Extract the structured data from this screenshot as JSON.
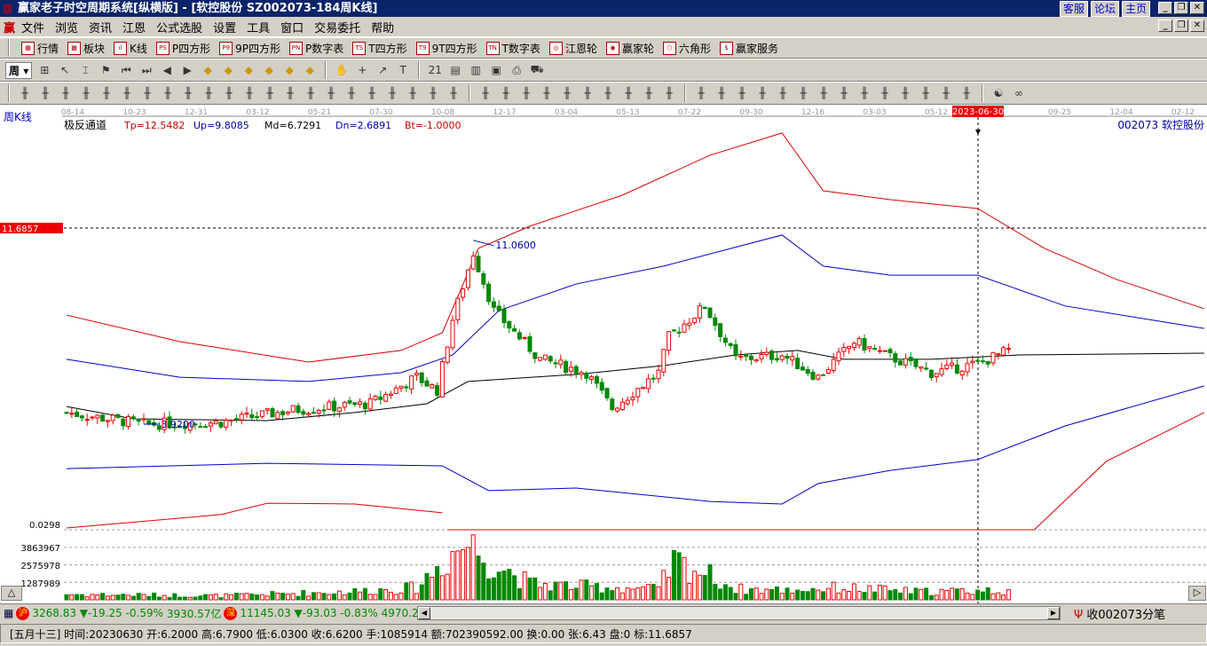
{
  "window": {
    "title": "赢家老子时空周期系统[纵横版] - [软控股份   SZ002073-184周K线]",
    "links": [
      "客服",
      "论坛",
      "主页"
    ],
    "logo": "赢"
  },
  "menu": [
    "文件",
    "浏览",
    "资讯",
    "江恩",
    "公式选股",
    "设置",
    "工具",
    "窗口",
    "交易委托",
    "帮助"
  ],
  "toolbar1": [
    {
      "icon": "quote-table-icon",
      "label": "行情",
      "glyph": "▦"
    },
    {
      "icon": "sector-icon",
      "label": "板块",
      "glyph": "▩"
    },
    {
      "icon": "kline-icon",
      "label": "K线",
      "glyph": "ıl"
    },
    {
      "icon": "ps-icon",
      "label": "P四方形",
      "glyph": "PS"
    },
    {
      "icon": "p9-icon",
      "label": "9P四方形",
      "glyph": "P9"
    },
    {
      "icon": "pn-icon",
      "label": "P数字表",
      "glyph": "PN"
    },
    {
      "icon": "ts-icon",
      "label": "T四方形",
      "glyph": "TS"
    },
    {
      "icon": "t9-icon",
      "label": "9T四方形",
      "glyph": "T9"
    },
    {
      "icon": "tn-icon",
      "label": "T数字表",
      "glyph": "TN"
    },
    {
      "icon": "gann-wheel-icon",
      "label": "江恩轮",
      "glyph": "◎"
    },
    {
      "icon": "winner-wheel-icon",
      "label": "赢家轮",
      "glyph": "◉"
    },
    {
      "icon": "hexagon-icon",
      "label": "六角形",
      "glyph": "⬡"
    },
    {
      "icon": "dollar-icon",
      "label": "赢家服务",
      "glyph": "$"
    }
  ],
  "period": "周",
  "chart": {
    "period_label": "周K线",
    "indicator_name": "极反通道",
    "tp": "Tp=12.5482",
    "up": "Up=9.8085",
    "md": "Md=6.7291",
    "dn": "Dn=2.6891",
    "bt": "Bt=-1.0000",
    "stock": "002073  软控股份",
    "price_marker": "11.6857",
    "high_label": "11.0600",
    "low_label": "3.9200",
    "indicator_value": "0.0298",
    "vol_ticks": [
      "3863967",
      "2575978",
      "1287989"
    ],
    "dates": [
      "08-14",
      "10-23",
      "12-31",
      "03-12",
      "05-21",
      "07-30",
      "10-08",
      "12-17",
      "03-04",
      "05-13",
      "07-22",
      "09-30",
      "12-16",
      "03-03",
      "05-12",
      "2023-06-30",
      "09-25",
      "12-04",
      "02-12"
    ]
  },
  "chart_data": {
    "type": "candlestick",
    "weeks": 184,
    "close_keypoints": [
      [
        0,
        4.38
      ],
      [
        15,
        3.92
      ],
      [
        30,
        4.0
      ],
      [
        44,
        4.48
      ],
      [
        59,
        4.73
      ],
      [
        68,
        5.78
      ],
      [
        72,
        5.26
      ],
      [
        75,
        8.07
      ],
      [
        79,
        10.7
      ],
      [
        83,
        8.42
      ],
      [
        92,
        6.49
      ],
      [
        101,
        5.96
      ],
      [
        106,
        4.55
      ],
      [
        115,
        5.96
      ],
      [
        117,
        7.37
      ],
      [
        124,
        8.6
      ],
      [
        130,
        6.49
      ],
      [
        139,
        6.66
      ],
      [
        146,
        5.78
      ],
      [
        153,
        7.19
      ],
      [
        159,
        6.66
      ],
      [
        168,
        5.96
      ],
      [
        177,
        6.31
      ],
      [
        183,
        6.84
      ]
    ],
    "channels": {
      "tp": [
        [
          0,
          8.24
        ],
        [
          22,
          7.19
        ],
        [
          47,
          6.38
        ],
        [
          65,
          6.84
        ],
        [
          73,
          7.54
        ],
        [
          80,
          10.88
        ],
        [
          90,
          11.76
        ],
        [
          108,
          12.99
        ],
        [
          125,
          14.57
        ],
        [
          139,
          15.45
        ],
        [
          147,
          13.16
        ],
        [
          160,
          12.81
        ],
        [
          177,
          12.46
        ],
        [
          190,
          10.88
        ],
        [
          204,
          9.65
        ],
        [
          221,
          8.49
        ]
      ],
      "up": [
        [
          0,
          6.49
        ],
        [
          22,
          5.78
        ],
        [
          47,
          5.61
        ],
        [
          65,
          5.96
        ],
        [
          75,
          6.66
        ],
        [
          84,
          8.42
        ],
        [
          99,
          9.47
        ],
        [
          116,
          10.18
        ],
        [
          139,
          11.41
        ],
        [
          147,
          10.18
        ],
        [
          160,
          9.82
        ],
        [
          177,
          9.82
        ],
        [
          194,
          8.6
        ],
        [
          221,
          7.71
        ]
      ],
      "md": [
        [
          0,
          4.62
        ],
        [
          13,
          4.13
        ],
        [
          39,
          4.06
        ],
        [
          56,
          4.38
        ],
        [
          70,
          4.73
        ],
        [
          78,
          5.61
        ],
        [
          99,
          5.89
        ],
        [
          116,
          6.24
        ],
        [
          130,
          6.66
        ],
        [
          142,
          6.84
        ],
        [
          151,
          6.49
        ],
        [
          168,
          6.49
        ],
        [
          185,
          6.66
        ],
        [
          221,
          6.73
        ]
      ],
      "dn": [
        [
          0,
          2.16
        ],
        [
          39,
          2.37
        ],
        [
          73,
          2.27
        ],
        [
          82,
          1.29
        ],
        [
          99,
          1.39
        ],
        [
          125,
          0.86
        ],
        [
          139,
          0.76
        ],
        [
          146,
          1.57
        ],
        [
          160,
          2.09
        ],
        [
          177,
          2.52
        ],
        [
          194,
          3.85
        ],
        [
          221,
          5.43
        ]
      ],
      "bt_a": [
        [
          0,
          -0.19
        ],
        [
          30,
          0.34
        ],
        [
          39,
          0.79
        ],
        [
          56,
          0.76
        ],
        [
          73,
          0.41
        ]
      ],
      "bt_b": [
        [
          74,
          -0.26
        ],
        [
          188,
          -0.26
        ],
        [
          202,
          2.45
        ],
        [
          221,
          4.38
        ]
      ]
    },
    "volume_keypoints": [
      [
        0,
        400000
      ],
      [
        30,
        300000
      ],
      [
        55,
        600000
      ],
      [
        68,
        900000
      ],
      [
        75,
        3500000
      ],
      [
        78,
        4200000
      ],
      [
        82,
        3000000
      ],
      [
        90,
        1200000
      ],
      [
        100,
        1000000
      ],
      [
        115,
        800000
      ],
      [
        118,
        2800000
      ],
      [
        124,
        2000000
      ],
      [
        130,
        800000
      ],
      [
        140,
        700000
      ],
      [
        150,
        900000
      ],
      [
        165,
        600000
      ],
      [
        183,
        700000
      ]
    ],
    "price_marker": 11.6857,
    "selected_week": 177
  },
  "status": {
    "sh_index": "3268.83",
    "sh_change": "▼-19.25",
    "sh_pct": "-0.59%",
    "sh_amount": "3930.57亿",
    "sz_index": "11145.03",
    "sz_change": "▼-93.03",
    "sz_pct": "-0.83%",
    "sz_amount": "4970.2",
    "tick_label": "收002073分笔",
    "sh_badge": "沪",
    "sz_badge": "深"
  },
  "info": "[五月十三] 时间:20230630 开:6.2000 高:6.7900 低:6.0300 收:6.6200 手:1085914 额:702390592.00 换:0.00 张:6.43 盘:0 标:11.6857"
}
